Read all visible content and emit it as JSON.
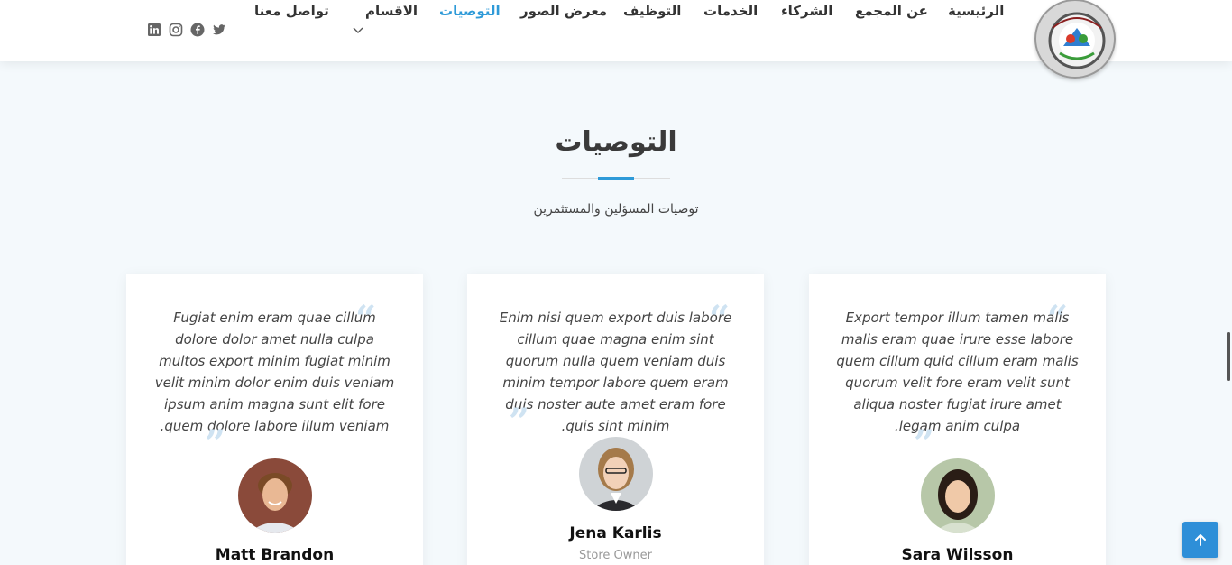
{
  "header": {
    "nav": [
      {
        "label": "الرئيسية"
      },
      {
        "label": "عن المجمع"
      },
      {
        "label": "الشركاء"
      },
      {
        "label": "الخدمات"
      },
      {
        "label": "التوظيف"
      },
      {
        "label": "معرض الصور"
      },
      {
        "label": "التوصيات",
        "active": true
      },
      {
        "label": "الاقسام",
        "has_dropdown": true
      },
      {
        "label": "تواصل معنا"
      }
    ],
    "social_icons": [
      "twitter-icon",
      "facebook-icon",
      "instagram-icon",
      "linkedin-icon"
    ],
    "accent_color": "#2e9ad8"
  },
  "section": {
    "title": "التوصيات",
    "subtitle": "توصيات المسؤلين والمستثمرين"
  },
  "testimonials": [
    {
      "quote": "Export tempor illum tamen malis malis eram quae irure esse labore quem cillum quid cillum eram malis quorum velit fore eram velit sunt aliqua noster fugiat irure amet legam anim culpa.",
      "name": "Sara Wilsson",
      "role": ""
    },
    {
      "quote": "Enim nisi quem export duis labore cillum quae magna enim sint quorum nulla quem veniam duis minim tempor labore quem eram duis noster aute amet eram fore quis sint minim.",
      "name": "Jena Karlis",
      "role": "Store Owner"
    },
    {
      "quote": "Fugiat enim eram quae cillum dolore dolor amet nulla culpa multos export minim fugiat minim velit minim dolor enim duis veniam ipsum anim magna sunt elit fore quem dolore labore illum veniam.",
      "name": "Matt Brandon",
      "role": ""
    }
  ],
  "back_to_top_icon": "arrow-up-icon"
}
